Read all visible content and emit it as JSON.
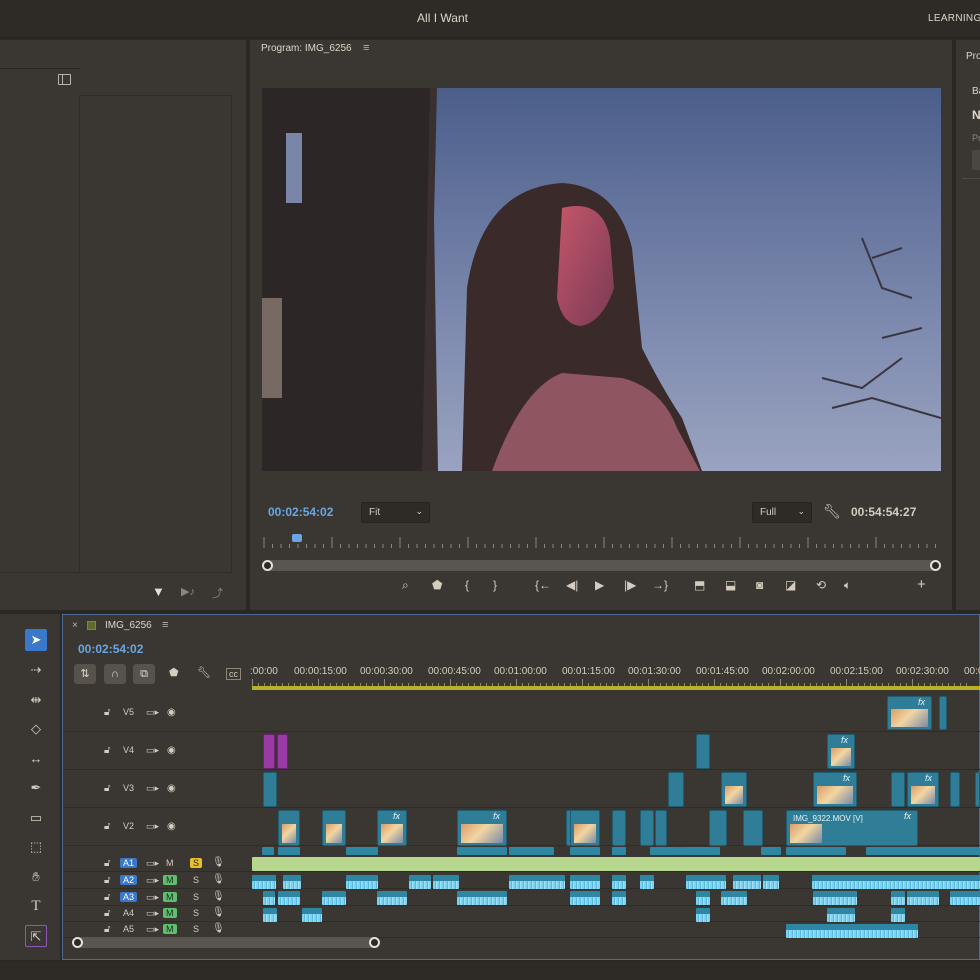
{
  "app": {
    "title": "All I Want",
    "workspace_label": "LEARNING"
  },
  "program_monitor": {
    "title": "Program: IMG_6256",
    "menu_icon": "≡",
    "timecode_current": "00:02:54:02",
    "fit_label": "Fit",
    "quality_label": "Full",
    "timecode_duration": "00:54:54:27",
    "playhead_fraction": 0.04
  },
  "right_panel": {
    "t1": "Pro",
    "t2": "Ba",
    "t3": "N",
    "t4": "Pr"
  },
  "timeline": {
    "close_label": "×",
    "sequence_name": "IMG_6256",
    "menu_icon": "≡",
    "timecode": "00:02:54:02",
    "ruler_labels": [
      ":00:00",
      "00:00:15:00",
      "00:00:30:00",
      "00:00:45:00",
      "00:01:00:00",
      "00:01:15:00",
      "00:01:30:00",
      "00:01:45:00",
      "00:02:00:00",
      "00:02:15:00",
      "00:02:30:00",
      "00:0"
    ],
    "video_tracks": [
      {
        "name": "V5"
      },
      {
        "name": "V4"
      },
      {
        "name": "V3"
      },
      {
        "name": "V2"
      }
    ],
    "audio_tracks": [
      {
        "name": "A1",
        "m": "M",
        "s": "S",
        "name_selected": true,
        "m_on": false,
        "s_on": true
      },
      {
        "name": "A2",
        "m": "M",
        "s": "S",
        "name_selected": true,
        "m_on": true,
        "s_on": false
      },
      {
        "name": "A3",
        "m": "M",
        "s": "S",
        "name_selected": true,
        "m_on": true,
        "s_on": false
      },
      {
        "name": "A4",
        "m": "M",
        "s": "S",
        "name_selected": false,
        "m_on": true,
        "s_on": false
      },
      {
        "name": "A5",
        "m": "M",
        "s": "S",
        "name_selected": false,
        "m_on": true,
        "s_on": false
      }
    ],
    "clip_labels": {
      "v2_named": "IMG_9322.MOV [V]",
      "fx": "fx"
    }
  },
  "icons": {
    "filter": "filter-icon",
    "wrench": "wrench-icon",
    "lock": "lock-icon",
    "eye": "eye-icon",
    "mic": "microphone-icon",
    "camera": "camera-icon"
  },
  "colors": {
    "accent_blue": "#6aa6e6",
    "track_select": "#3a78c9",
    "clip_teal": "#2f7d97",
    "solo_yellow": "#e5c02c",
    "mute_green": "#5fbf6f",
    "in_out_bar": "#b8b326"
  }
}
